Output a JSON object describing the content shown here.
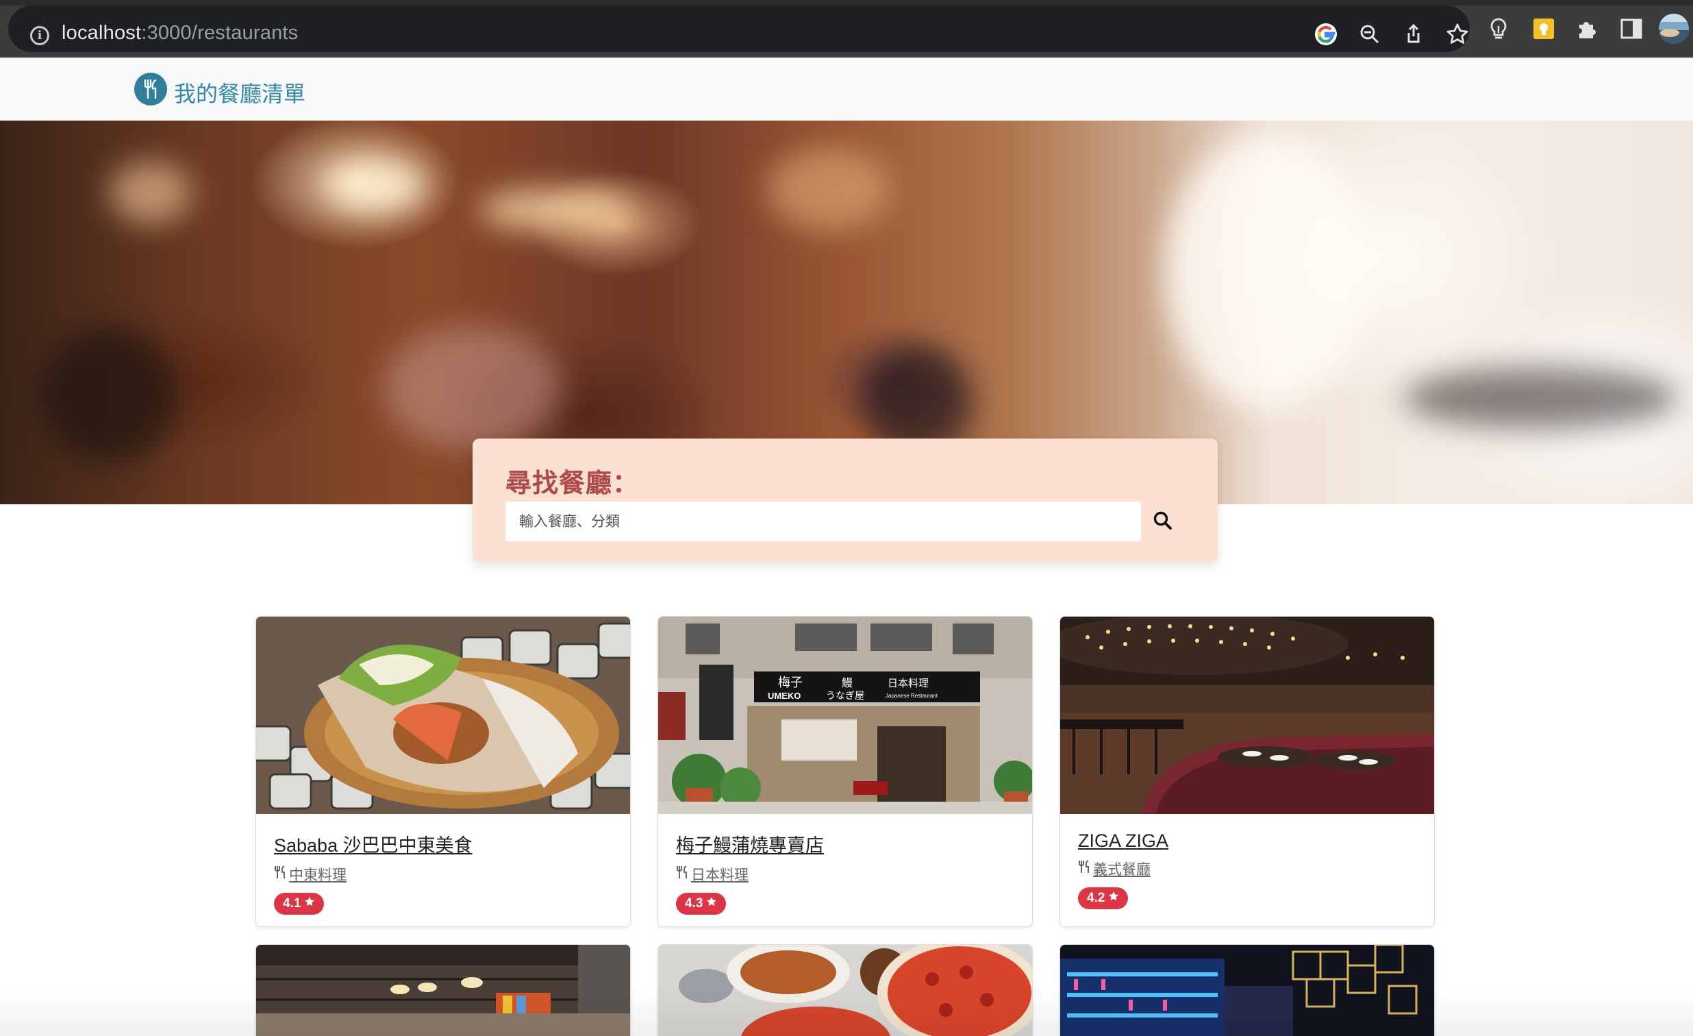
{
  "browser": {
    "url_host": "localhost",
    "url_path": ":3000/restaurants",
    "toolbar_icons": [
      "google-icon",
      "zoom-out-icon",
      "share-icon",
      "bookmark-star-icon",
      "lightbulb-icon",
      "keep-notes-icon",
      "extensions-puzzle-icon",
      "side-panel-icon",
      "profile-avatar-icon"
    ]
  },
  "navbar": {
    "brand": "我的餐廳清單",
    "logo_icon": "utensils-icon",
    "colors": {
      "brand": "#3587a8",
      "logo_bg": "#2f7f9c"
    }
  },
  "search": {
    "title": "尋找餐廳：",
    "placeholder": "輸入餐廳、分類",
    "value": "",
    "button_icon": "search-icon",
    "colors": {
      "panel": "#fce0d2",
      "title": "#b04a4a"
    }
  },
  "restaurants": [
    {
      "name": "Sababa 沙巴巴中東美食",
      "category": "中東料理",
      "rating": "4.1"
    },
    {
      "name": "梅子鰻蒲燒專賣店",
      "category": "日本料理",
      "rating": "4.3"
    },
    {
      "name": "ZIGA ZIGA",
      "category": "義式餐廳",
      "rating": "4.2"
    }
  ],
  "rating_badge_color": "#dc3545",
  "storefront_sign": {
    "line1": "梅子",
    "line2": "UMEKO",
    "line3": "鰻",
    "line4": "うなぎ屋",
    "line5": "日本料理",
    "line6": "Japanese Restaurant"
  }
}
